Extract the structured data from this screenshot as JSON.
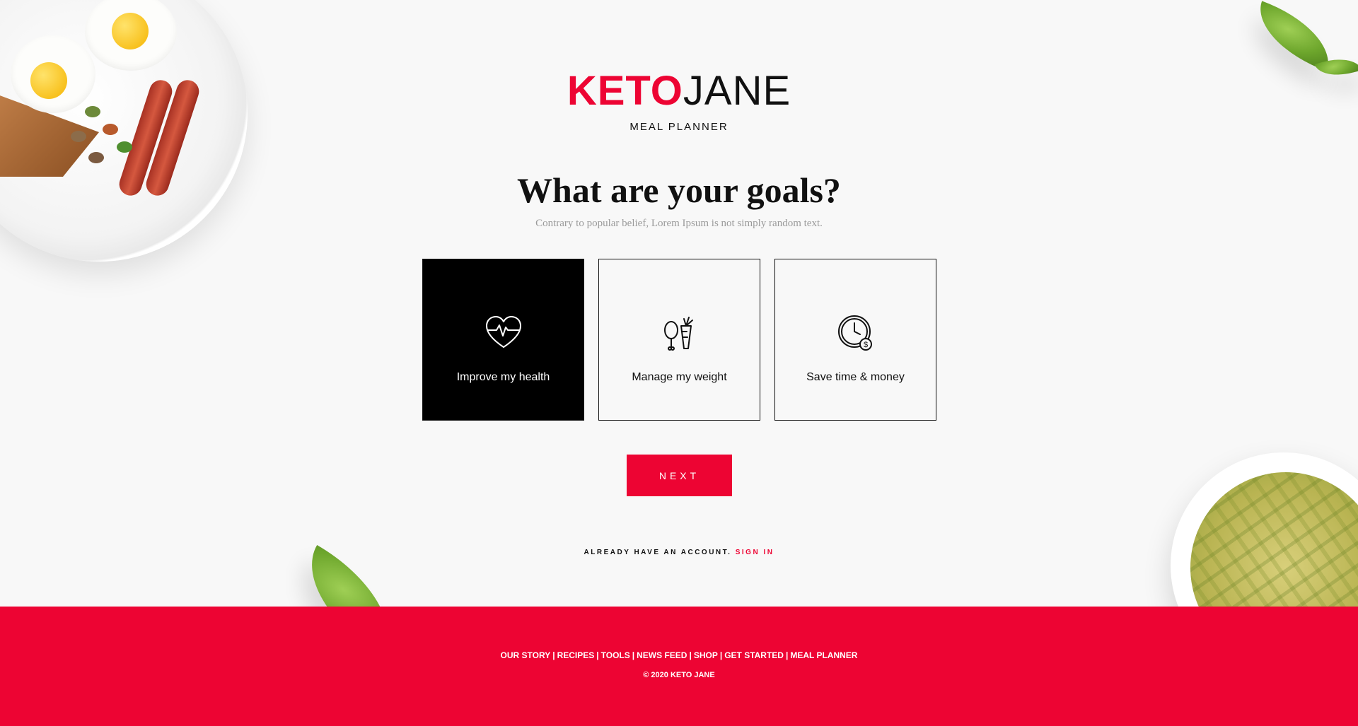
{
  "brand": {
    "logo_part1": "KETO",
    "logo_part2": "JANE",
    "subtitle": "MEAL PLANNER",
    "accent_color": "#ed0433"
  },
  "main": {
    "title": "What are your goals?",
    "subtitle": "Contrary to popular belief, Lorem Ipsum is not simply random text.",
    "goals": [
      {
        "label": "Improve my health",
        "icon": "heart-pulse-icon",
        "selected": true
      },
      {
        "label": "Manage my weight",
        "icon": "chicken-carrot-icon",
        "selected": false
      },
      {
        "label": "Save time & money",
        "icon": "clock-money-icon",
        "selected": false
      }
    ],
    "next_label": "NEXT",
    "account_question": "ALREADY HAVE AN ACCOUNT.",
    "signin_label": "SIGN IN"
  },
  "footer": {
    "links": [
      "OUR STORY",
      "RECIPES",
      "TOOLS",
      "NEWS FEED",
      "SHOP",
      "GET STARTED",
      "MEAL PLANNER"
    ],
    "separator": "|",
    "copyright": "© 2020 KETO JANE"
  }
}
